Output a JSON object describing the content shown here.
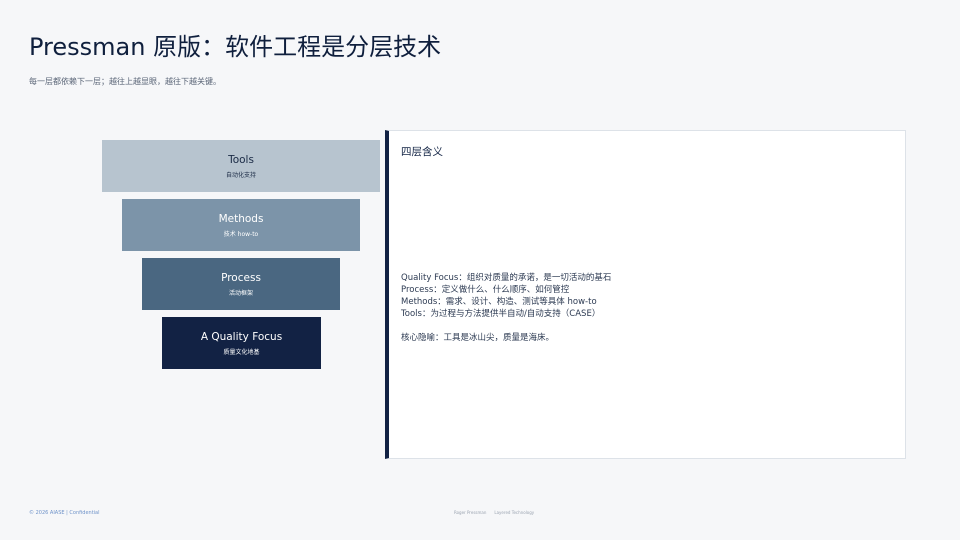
{
  "header": {
    "title": "Pressman 原版：软件工程是分层技术",
    "subtitle": "每一层都依赖下一层；越往上越显眼，越往下越关键。"
  },
  "layers": [
    {
      "name": "Tools",
      "desc": "自动化支持",
      "color": "#b7c4cf"
    },
    {
      "name": "Methods",
      "desc": "技术 how-to",
      "color": "#7c94a9"
    },
    {
      "name": "Process",
      "desc": "活动框架",
      "color": "#4a6781"
    },
    {
      "name": "A Quality Focus",
      "desc": "质量文化地基",
      "color": "#122244"
    }
  ],
  "panel": {
    "title": "四层含义",
    "lines": [
      "Quality Focus：组织对质量的承诺，是一切活动的基石",
      "Process：定义做什么、什么顺序、如何管控",
      "Methods：需求、设计、构造、测试等具体 how-to",
      "Tools：为过程与方法提供半自动/自动支持（CASE）"
    ],
    "note": "核心隐喻：工具是冰山尖，质量是海床。",
    "accent": "#122244"
  },
  "footer": {
    "left": "© 2026  AIASE  |  Confidential",
    "center_1": "Roger Pressman",
    "center_2": "Layered Technology"
  }
}
